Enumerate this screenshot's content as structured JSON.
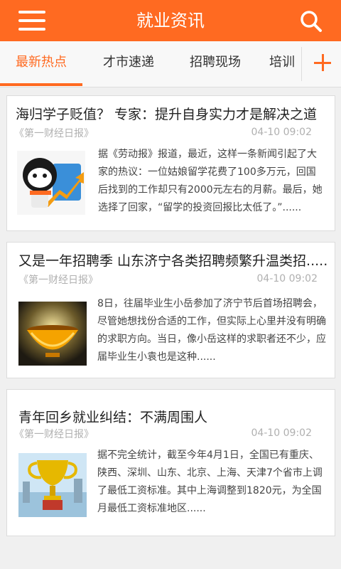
{
  "header": {
    "title": "就业资讯"
  },
  "tabs": [
    {
      "label": "最新热点",
      "active": true
    },
    {
      "label": "才市速递",
      "active": false
    },
    {
      "label": "招聘现场",
      "active": false
    },
    {
      "label": "培训",
      "active": false
    }
  ],
  "colors": {
    "accent": "#ff6a21"
  },
  "icons": {
    "menu": "hamburger-menu-icon",
    "search": "search-icon",
    "add": "plus-icon"
  },
  "news": [
    {
      "title": "海归学子贬值？ 专家：提升自身实力才是解决之道",
      "source": "《第一财经日报》",
      "time": "04-10 09:02",
      "summary": "据《劳动报》报道，最近，这样一条新闻引起了大家的热议：一位姑娘留学花费了100多万元，回国后找到的工作却只有2000元左右的月薪。最后，她选择了回家，“留学的投资回报比太低了。”......"
    },
    {
      "title": "又是一年招聘季 山东济宁各类招聘频繁升温类招.....",
      "source": "《第一财经日报》",
      "time": "04-10 09:02",
      "summary": "8日，往届毕业生小岳参加了济宁节后首场招聘会，尽管她想找份合适的工作，但实际上心里并没有明确的求职方向。当日，像小岳这样的求职者还不少，应届毕业生小袁也是这种......"
    },
    {
      "title": "青年回乡就业纠结：不满周围人",
      "source": "《第一财经日报》",
      "time": "04-10 09:02",
      "summary": "据不完全统计，截至今年4月1日，全国已有重庆、陕西、深圳、山东、北京、上海、天津7个省市上调了最低工资标准。其中上海调整到1820元，为全国月最低工资标准地区......"
    }
  ]
}
